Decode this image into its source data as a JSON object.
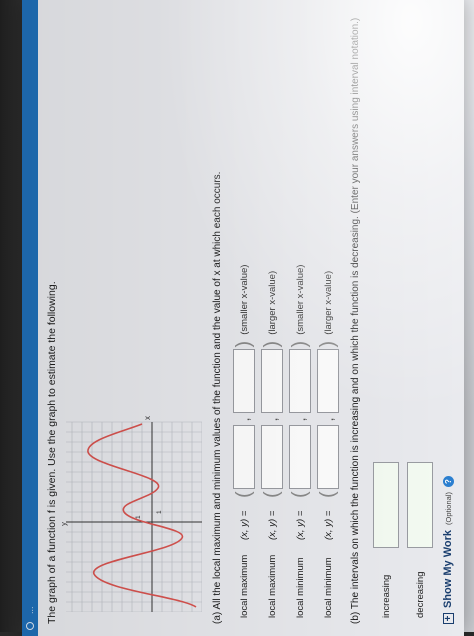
{
  "header": {
    "title": "..."
  },
  "problem": {
    "prompt": "The graph of a function f is given. Use the graph to estimate the following.",
    "graph": {
      "y_axis_label": "y",
      "x_axis_label": "x",
      "tick_label_x": "1",
      "tick_label_y": "1",
      "curve_color": "#d9534f"
    },
    "part_a": {
      "instruction": "(a) All the local maximum and minimum values of the function and the value of x at which each occurs.",
      "rows": [
        {
          "label": "local maximum",
          "xy": "(x, y) =",
          "note": "(smaller x-value)"
        },
        {
          "label": "local maximum",
          "xy": "(x, y) =",
          "note": "(larger x-value)"
        },
        {
          "label": "local minimum",
          "xy": "(x, y) =",
          "note": "(smaller x-value)"
        },
        {
          "label": "local minimum",
          "xy": "(x, y) =",
          "note": "(larger x-value)"
        }
      ]
    },
    "part_b": {
      "instruction": "(b) The intervals on which the function is increasing and on which the function is decreasing. (Enter your answers using interval notation.)",
      "increasing_label": "increasing",
      "decreasing_label": "decreasing"
    }
  },
  "show_work": {
    "label": "Show My Work",
    "optional": "(Optional)",
    "help_glyph": "?"
  }
}
